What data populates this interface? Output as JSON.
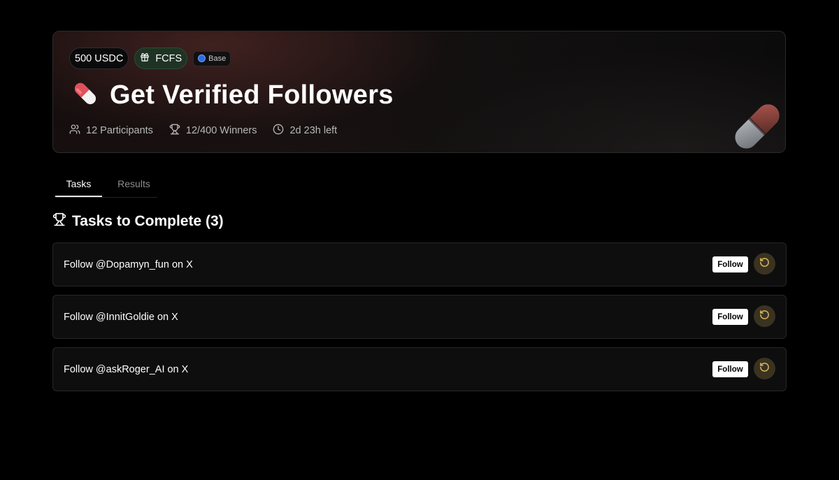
{
  "hero": {
    "reward_badge": "500 USDC",
    "type_badge": "FCFS",
    "network_badge": "Base",
    "title": "Get Verified Followers",
    "stats": {
      "participants": "12 Participants",
      "winners": "12/400 Winners",
      "time_left": "2d 23h left"
    }
  },
  "tabs": [
    {
      "label": "Tasks",
      "active": true
    },
    {
      "label": "Results",
      "active": false
    }
  ],
  "section": {
    "title": "Tasks to Complete (3)"
  },
  "tasks": [
    {
      "label": "Follow @Dopamyn_fun on X",
      "button": "Follow"
    },
    {
      "label": "Follow @InnitGoldie on X",
      "button": "Follow"
    },
    {
      "label": "Follow @askRoger_AI on X",
      "button": "Follow"
    }
  ],
  "colors": {
    "background": "#000000",
    "fcfs_badge": "#1f3324",
    "base_dot": "#2f6be3",
    "refresh_bg": "#3a3322",
    "refresh_icon": "#d8b55a"
  },
  "icons": {
    "fcfs": "gift-icon",
    "title": "pill-icon",
    "participants": "users-icon",
    "winners": "trophy-icon",
    "time": "clock-icon",
    "section": "trophy-icon",
    "verify": "refresh-icon"
  }
}
